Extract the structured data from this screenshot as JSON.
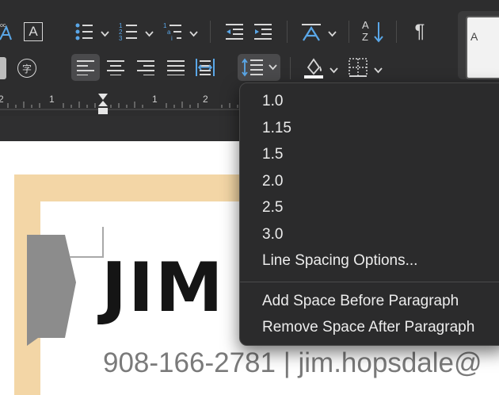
{
  "ribbon": {
    "icons": [
      "text-highlight-icon",
      "character-border-icon",
      "bullets-icon",
      "numbering-icon",
      "multilevel-list-icon",
      "decrease-indent-icon",
      "increase-indent-icon",
      "text-direction-icon",
      "sort-icon",
      "show-formatting-icon",
      "character-shading-icon",
      "phonetic-guide-icon",
      "align-left-icon",
      "center-icon",
      "align-right-icon",
      "justify-icon",
      "distributed-icon",
      "line-spacing-icon",
      "shading-icon",
      "borders-icon"
    ],
    "character_border_glyph": "A",
    "sort_top_glyph": "A",
    "sort_bottom_glyph": "Z",
    "phonetic_glyph": "字",
    "pilcrow_glyph": "¶",
    "style_preview_glyph": "A"
  },
  "ruler": {
    "labels": [
      "2",
      "1",
      "1",
      "2"
    ]
  },
  "document": {
    "name": "JIM",
    "contact": "908-166-2781 | jim.hopsdale@"
  },
  "line_spacing_menu": {
    "spacing_options": [
      "1.0",
      "1.15",
      "1.5",
      "2.0",
      "2.5",
      "3.0"
    ],
    "options_label": "Line Spacing Options...",
    "add_before": "Add Space Before Paragraph",
    "remove_after": "Remove Space After Paragraph"
  },
  "colors": {
    "ribbon_bg": "#2d2d2e",
    "menu_bg": "#2b2b2c",
    "page_border": "#f3d6a6",
    "accent_blue": "#5aa7e8",
    "accent_green": "#8ad26a"
  }
}
